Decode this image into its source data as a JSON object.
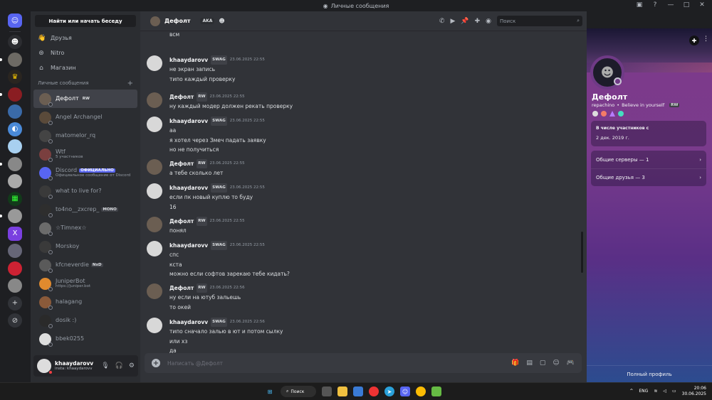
{
  "window": {
    "title": "Личные сообщения",
    "title_icon": "discord-icon"
  },
  "dm_sidebar": {
    "search_label": "Найти или начать беседу",
    "nav": [
      {
        "label": "Друзья",
        "icon": "friends-icon"
      },
      {
        "label": "Nitro",
        "icon": "nitro-icon"
      },
      {
        "label": "Магазин",
        "icon": "shop-icon"
      }
    ],
    "header": "Личные сообщения",
    "items": [
      {
        "name": "Дефолт",
        "tag": "RW",
        "sub": ""
      },
      {
        "name": "Angel Archangel",
        "tag": "",
        "sub": ""
      },
      {
        "name": "matomelor_rq",
        "tag": "",
        "sub": ""
      },
      {
        "name": "Wtf",
        "tag": "",
        "sub": "5 участников"
      },
      {
        "name": "Discord",
        "tag": "ОФИЦИАЛЬНО",
        "sub": "Официальное сообщение от Discord"
      },
      {
        "name": "what to live for?",
        "tag": "",
        "sub": ""
      },
      {
        "name": "to4no__zxcrep_",
        "tag": "MONO",
        "sub": ""
      },
      {
        "name": "☆Timnex☆",
        "tag": "",
        "sub": ""
      },
      {
        "name": "Morskoy",
        "tag": "",
        "sub": ""
      },
      {
        "name": "kfcneverdie",
        "tag": "NxD",
        "sub": ""
      },
      {
        "name": "JuniperBot",
        "tag": "",
        "sub": "https://juniper.bot"
      },
      {
        "name": "halagang",
        "tag": "",
        "sub": ""
      },
      {
        "name": "dosik :)",
        "tag": "",
        "sub": ""
      },
      {
        "name": "bbek0255",
        "tag": "",
        "sub": ""
      }
    ],
    "user": {
      "name": "khaaydarovv",
      "status": "insta: khaaydarovv"
    }
  },
  "chat": {
    "header_name": "Дефолт",
    "aka": "AKA",
    "search_placeholder": "Поиск",
    "composer_placeholder": "Написать @Дефолт",
    "messages": [
      {
        "user": "",
        "tag": "",
        "time": "",
        "lines": [
          "всм"
        ]
      },
      {
        "user": "khaaydarovv",
        "tag": "SWAG",
        "time": "23.06.2025 22:55",
        "lines": [
          "не экран запись",
          "типо каждый проверку"
        ]
      },
      {
        "user": "Дефолт",
        "tag": "RW",
        "time": "23.06.2025 22:55",
        "lines": [
          "ну каждый модер должен рекать проверку"
        ]
      },
      {
        "user": "khaaydarovv",
        "tag": "SWAG",
        "time": "23.06.2025 22:55",
        "lines": [
          "аа",
          "я хотел через Змеч падать заявку",
          "но не получиться"
        ]
      },
      {
        "user": "Дефолт",
        "tag": "RW",
        "time": "23.06.2025 22:55",
        "lines": [
          "а тебе сколько лет"
        ]
      },
      {
        "user": "khaaydarovv",
        "tag": "SWAG",
        "time": "23.06.2025 22:55",
        "lines": [
          "если пк новый куплю то буду",
          "16"
        ]
      },
      {
        "user": "Дефолт",
        "tag": "RW",
        "time": "23.06.2025 22:55",
        "lines": [
          "понял"
        ]
      },
      {
        "user": "khaaydarovv",
        "tag": "SWAG",
        "time": "23.06.2025 22:55",
        "lines": [
          "спс",
          "кста",
          "можно если софтов зарекаю тебе кидать?"
        ]
      },
      {
        "user": "Дефолт",
        "tag": "RW",
        "time": "23.06.2025 22:56",
        "lines": [
          "ну если на ютуб зальешь",
          "то окей"
        ]
      },
      {
        "user": "khaaydarovv",
        "tag": "SWAG",
        "time": "23.06.2025 22:56",
        "lines": [
          "типо сначало залью в ют и потом сылку",
          "или хз",
          "да"
        ]
      }
    ]
  },
  "profile": {
    "name": "Дефолт",
    "username": "repachino",
    "bio": "Believe in yourself",
    "tag": "RW",
    "member_since_title": "В числе участников с",
    "member_since": "2 дек. 2019 г.",
    "servers": "Общие серверы — 1",
    "friends": "Общие друзья — 3",
    "full_profile": "Полный профиль"
  },
  "taskbar": {
    "search": "Поиск",
    "lang": "ENG",
    "time": "20:06",
    "date": "30.06.2025"
  }
}
